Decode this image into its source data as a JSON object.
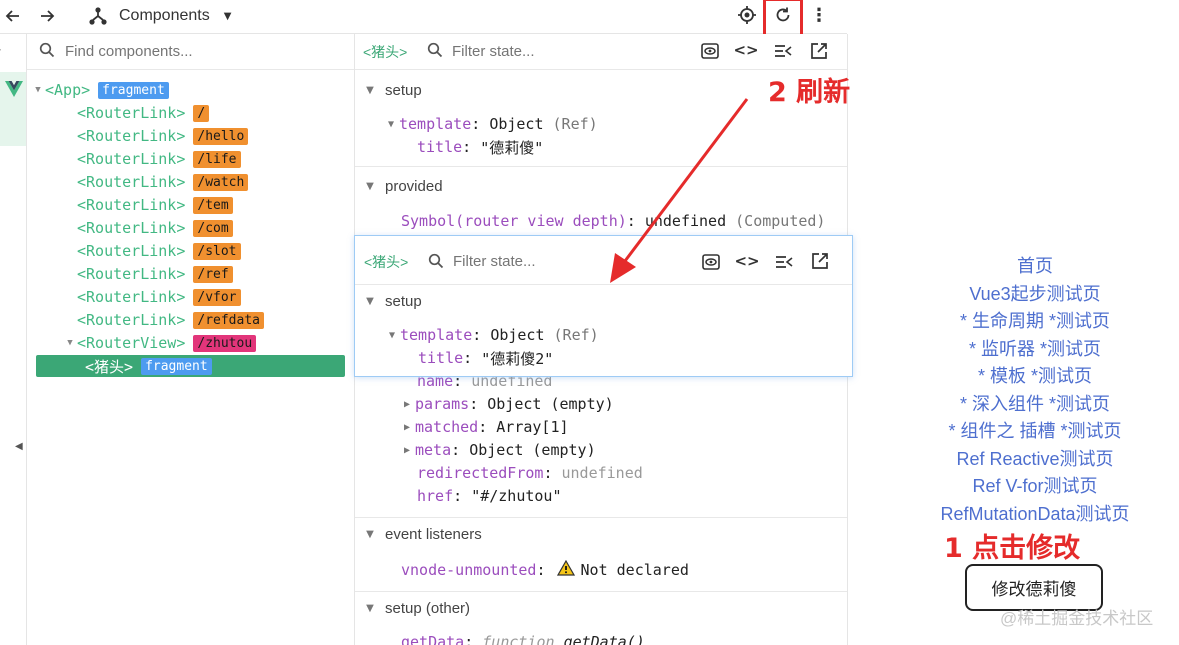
{
  "toolbar": {
    "title": "Components",
    "back_icon": "back-arrow-icon",
    "forward_icon": "forward-arrow-icon",
    "refresh_highlight_color": "#e52b2b"
  },
  "tree": {
    "search_placeholder": "Find components...",
    "nodes": [
      {
        "label": "<App>",
        "badge": "fragment",
        "badge_color": "blue",
        "depth": 0,
        "expandable": true
      },
      {
        "label": "<RouterLink>",
        "badge": "/",
        "badge_color": "orange",
        "depth": 1
      },
      {
        "label": "<RouterLink>",
        "badge": "/hello",
        "badge_color": "orange",
        "depth": 1
      },
      {
        "label": "<RouterLink>",
        "badge": "/life",
        "badge_color": "orange",
        "depth": 1
      },
      {
        "label": "<RouterLink>",
        "badge": "/watch",
        "badge_color": "orange",
        "depth": 1
      },
      {
        "label": "<RouterLink>",
        "badge": "/tem",
        "badge_color": "orange",
        "depth": 1
      },
      {
        "label": "<RouterLink>",
        "badge": "/com",
        "badge_color": "orange",
        "depth": 1
      },
      {
        "label": "<RouterLink>",
        "badge": "/slot",
        "badge_color": "orange",
        "depth": 1
      },
      {
        "label": "<RouterLink>",
        "badge": "/ref",
        "badge_color": "orange",
        "depth": 1
      },
      {
        "label": "<RouterLink>",
        "badge": "/vfor",
        "badge_color": "orange",
        "depth": 1
      },
      {
        "label": "<RouterLink>",
        "badge": "/refdata",
        "badge_color": "orange",
        "depth": 1
      },
      {
        "label": "<RouterView>",
        "badge": "/zhutou",
        "badge_color": "pink",
        "depth": 1,
        "expandable": true
      },
      {
        "label": "<猪头>",
        "badge": "fragment",
        "badge_color": "blue",
        "depth": 2,
        "selected": true
      }
    ],
    "selected_color": "#3ba776"
  },
  "state": {
    "component": "<猪头>",
    "filter_placeholder": "Filter state...",
    "setup_label": "setup",
    "template_key": "template",
    "template_val": "Object",
    "template_ref": "(Ref)",
    "title_key": "title",
    "title_val": "\"德莉傻\"",
    "provided_label": "provided",
    "symbol_key": "Symbol(router view depth)",
    "symbol_val": "undefined",
    "symbol_note": "(Computed)",
    "name_key": "name",
    "name_val": "undefined",
    "params_key": "params",
    "params_val": "Object (empty)",
    "matched_key": "matched",
    "matched_val": "Array[1]",
    "meta_key": "meta",
    "meta_val": "Object (empty)",
    "redirected_key": "redirectedFrom",
    "redirected_val": "undefined",
    "href_key": "href",
    "href_val": "\"#/zhutou\"",
    "events_label": "event listeners",
    "vnode_key": "vnode-unmounted",
    "vnode_val": "Not declared",
    "setup_other_label": "setup (other)",
    "getdata_key": "getData",
    "getdata_fn": "function",
    "getdata_val": "getData()"
  },
  "overlay": {
    "component": "<猪头>",
    "filter_placeholder": "Filter state...",
    "setup_label": "setup",
    "template_key": "template",
    "template_val": "Object",
    "template_ref": "(Ref)",
    "title_key": "title",
    "title_val": "\"德莉傻2\""
  },
  "nav": {
    "links": [
      "首页",
      "Vue3起步测试页",
      "* 生命周期 *测试页",
      "* 监听器 *测试页",
      "* 模板 *测试页",
      "* 深入组件 *测试页",
      "* 组件之 插槽 *测试页",
      "Ref Reactive测试页",
      "Ref V-for测试页",
      "RefMutationData测试页"
    ],
    "button_label": "修改德莉傻"
  },
  "annotations": {
    "click_note": "1 点击修改",
    "refresh_note": "2 刷新",
    "color": "#e52b2b"
  },
  "watermark": "@稀土掘金技术社区"
}
